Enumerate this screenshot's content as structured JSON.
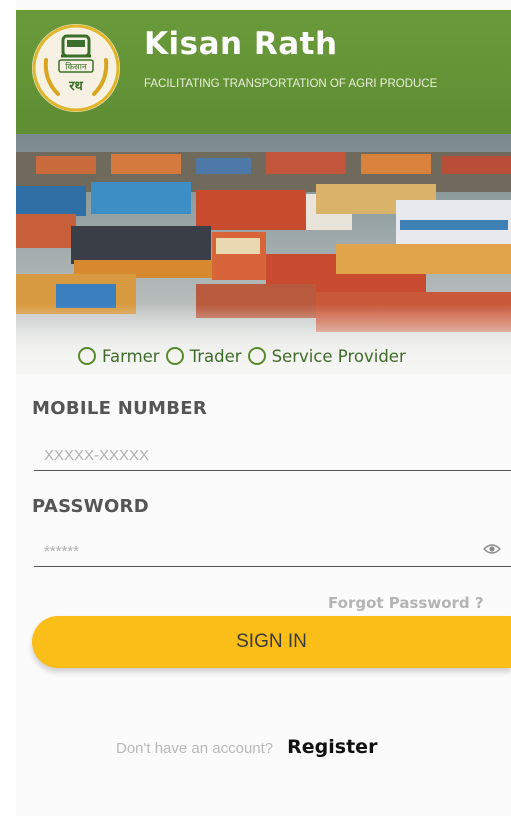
{
  "header": {
    "title": "Kisan Rath",
    "tagline": "FACILITATING TRANSPORTATION OF AGRI PRODUCE",
    "logo_text_top": "किसान",
    "logo_text_bottom": "रथ",
    "brand_color": "#5f8e33",
    "logo_icon": "truck-icon"
  },
  "banner": {
    "image": "truck-yard-photo"
  },
  "roles": {
    "options": [
      "Farmer",
      "Trader",
      "Service Provider"
    ],
    "selected": null
  },
  "form": {
    "mobile_label": "MOBILE NUMBER",
    "mobile_placeholder": "XXXXX-XXXXX",
    "password_label": "PASSWORD",
    "password_placeholder": "******",
    "forgot_label": "Forgot Password ?",
    "signin_label": "SIGN IN",
    "signin_color": "#fbbd18",
    "visibility_icon": "eye-icon"
  },
  "footer": {
    "prompt": "Don't have an account?",
    "register_label": "Register"
  }
}
